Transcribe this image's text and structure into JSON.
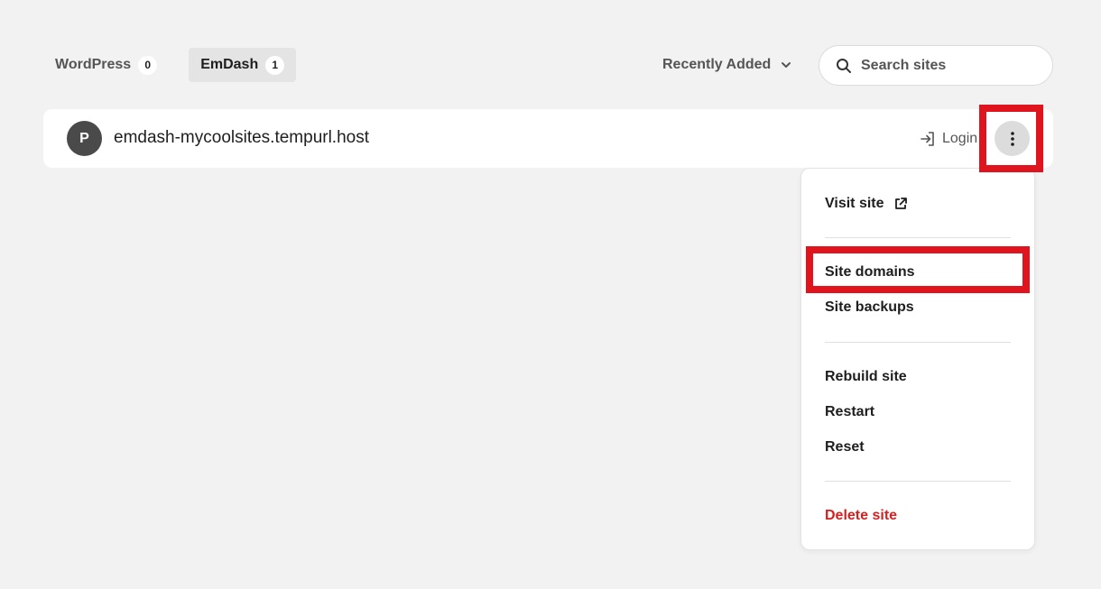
{
  "tabs": [
    {
      "label": "WordPress",
      "count": "0",
      "active": false
    },
    {
      "label": "EmDash",
      "count": "1",
      "active": true
    }
  ],
  "sort": {
    "label": "Recently Added"
  },
  "search": {
    "placeholder": "Search sites",
    "value": ""
  },
  "site": {
    "avatar_letter": "P",
    "name": "emdash-mycoolsites.tempurl.host",
    "login_label": "Login"
  },
  "menu": {
    "visit_site": "Visit site",
    "site_domains": "Site domains",
    "site_backups": "Site backups",
    "rebuild_site": "Rebuild site",
    "restart": "Restart",
    "reset": "Reset",
    "delete_site": "Delete site"
  },
  "colors": {
    "background": "#f2f2f2",
    "danger": "#d32121",
    "highlight": "#e0141c",
    "avatar": "#4a4a4a"
  }
}
